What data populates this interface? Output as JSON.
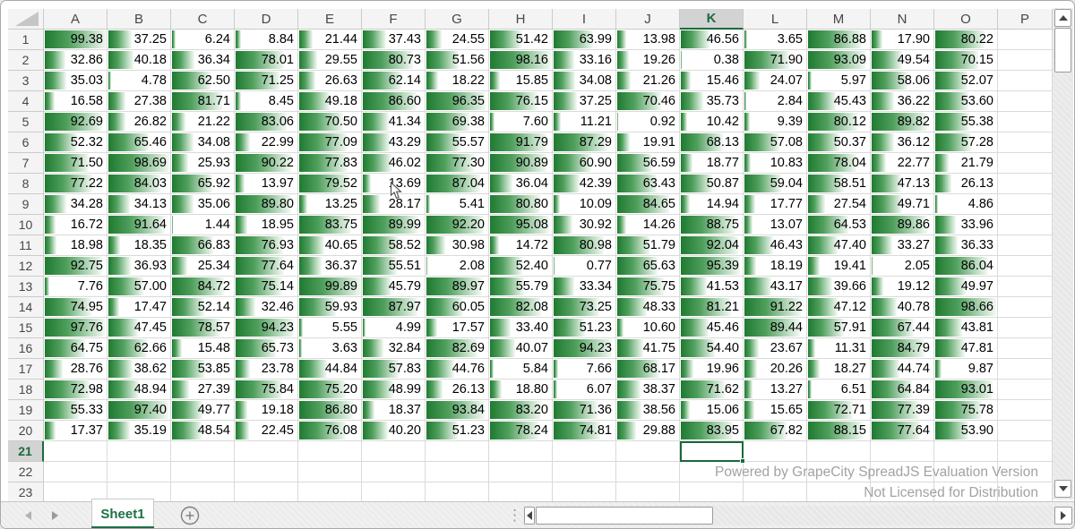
{
  "grid": {
    "columns": [
      "A",
      "B",
      "C",
      "D",
      "E",
      "F",
      "G",
      "H",
      "I",
      "J",
      "K",
      "L",
      "M",
      "N",
      "O",
      "P"
    ],
    "row_count": 23,
    "selected_column": "K",
    "selected_row": 21,
    "active_cell": "K21",
    "bar_color_start": "#1f7a31",
    "accent_green": "#17693c",
    "values": [
      [
        "99.38",
        "37.25",
        "6.24",
        "8.84",
        "21.44",
        "37.43",
        "24.55",
        "51.42",
        "63.99",
        "13.98",
        "46.56",
        "3.65",
        "86.88",
        "17.90",
        "80.22"
      ],
      [
        "32.86",
        "40.18",
        "36.34",
        "78.01",
        "29.55",
        "80.73",
        "51.56",
        "98.16",
        "33.16",
        "19.26",
        "0.38",
        "71.90",
        "93.09",
        "49.54",
        "70.15"
      ],
      [
        "35.03",
        "4.78",
        "62.50",
        "71.25",
        "26.63",
        "62.14",
        "18.22",
        "15.85",
        "34.08",
        "21.26",
        "15.46",
        "24.07",
        "5.97",
        "58.06",
        "52.07"
      ],
      [
        "16.58",
        "27.38",
        "81.71",
        "8.45",
        "49.18",
        "86.60",
        "96.35",
        "76.15",
        "37.25",
        "70.46",
        "35.73",
        "2.84",
        "45.43",
        "36.22",
        "53.60"
      ],
      [
        "92.69",
        "26.82",
        "21.22",
        "83.06",
        "70.50",
        "41.34",
        "69.38",
        "7.60",
        "11.21",
        "0.92",
        "10.42",
        "9.39",
        "80.12",
        "89.82",
        "55.38"
      ],
      [
        "52.32",
        "65.46",
        "34.08",
        "22.99",
        "77.09",
        "43.29",
        "55.57",
        "91.79",
        "87.29",
        "19.91",
        "68.13",
        "57.08",
        "50.37",
        "36.12",
        "57.28"
      ],
      [
        "71.50",
        "98.69",
        "25.93",
        "90.22",
        "77.83",
        "46.02",
        "77.30",
        "90.89",
        "60.90",
        "56.59",
        "18.77",
        "10.83",
        "78.04",
        "22.77",
        "21.79"
      ],
      [
        "77.22",
        "84.03",
        "65.92",
        "13.97",
        "79.52",
        "13.69",
        "87.04",
        "36.04",
        "42.39",
        "63.43",
        "50.87",
        "59.04",
        "58.51",
        "47.13",
        "26.13"
      ],
      [
        "34.28",
        "34.13",
        "35.06",
        "89.80",
        "13.25",
        "28.17",
        "5.41",
        "80.80",
        "10.09",
        "84.65",
        "14.94",
        "17.77",
        "27.54",
        "49.71",
        "4.86"
      ],
      [
        "16.72",
        "91.64",
        "1.44",
        "18.95",
        "83.75",
        "89.99",
        "92.20",
        "95.08",
        "30.92",
        "14.26",
        "88.75",
        "13.07",
        "64.53",
        "89.86",
        "33.96"
      ],
      [
        "18.98",
        "18.35",
        "66.83",
        "76.93",
        "40.65",
        "58.52",
        "30.98",
        "14.72",
        "80.98",
        "51.79",
        "92.04",
        "46.43",
        "47.40",
        "33.27",
        "36.33"
      ],
      [
        "92.75",
        "36.93",
        "25.34",
        "77.64",
        "36.37",
        "55.51",
        "2.08",
        "52.40",
        "0.77",
        "65.63",
        "95.39",
        "18.19",
        "19.41",
        "2.05",
        "86.04"
      ],
      [
        "7.76",
        "57.00",
        "84.72",
        "75.14",
        "99.89",
        "45.79",
        "89.97",
        "55.79",
        "33.34",
        "75.75",
        "41.53",
        "43.17",
        "39.66",
        "19.12",
        "49.97"
      ],
      [
        "74.95",
        "17.47",
        "52.14",
        "32.46",
        "59.93",
        "87.97",
        "60.05",
        "82.08",
        "73.25",
        "48.33",
        "81.21",
        "91.22",
        "47.12",
        "40.78",
        "98.66"
      ],
      [
        "97.76",
        "47.45",
        "78.57",
        "94.23",
        "5.55",
        "4.99",
        "17.57",
        "33.40",
        "51.23",
        "10.60",
        "45.46",
        "89.44",
        "57.91",
        "67.44",
        "43.81"
      ],
      [
        "64.75",
        "62.66",
        "15.48",
        "65.73",
        "3.63",
        "32.84",
        "82.69",
        "40.07",
        "94.23",
        "41.75",
        "54.40",
        "23.67",
        "11.31",
        "84.79",
        "47.81"
      ],
      [
        "28.76",
        "38.62",
        "53.85",
        "23.78",
        "44.84",
        "57.83",
        "44.76",
        "5.84",
        "7.66",
        "68.17",
        "19.96",
        "20.26",
        "18.27",
        "44.74",
        "9.87"
      ],
      [
        "72.98",
        "48.94",
        "27.39",
        "75.84",
        "75.20",
        "48.99",
        "26.13",
        "18.80",
        "6.07",
        "38.37",
        "71.62",
        "13.27",
        "6.51",
        "64.84",
        "93.01"
      ],
      [
        "55.33",
        "97.40",
        "49.77",
        "19.18",
        "86.80",
        "18.37",
        "93.84",
        "83.20",
        "71.36",
        "38.56",
        "15.06",
        "15.65",
        "72.71",
        "77.39",
        "75.78"
      ],
      [
        "17.37",
        "35.19",
        "48.54",
        "22.45",
        "76.08",
        "40.20",
        "51.23",
        "78.24",
        "74.81",
        "29.88",
        "83.95",
        "67.82",
        "88.15",
        "77.64",
        "53.90"
      ]
    ]
  },
  "watermark": {
    "line1": "Powered by GrapeCity SpreadJS Evaluation Version",
    "line2": "Not Licensed for Distribution"
  },
  "sheet_bar": {
    "tab_label": "Sheet1"
  }
}
